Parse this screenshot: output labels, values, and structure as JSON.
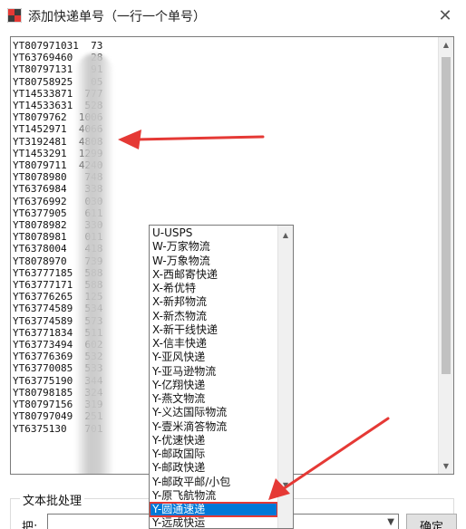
{
  "window": {
    "title": "添加快递单号（一行一个单号）",
    "close_glyph": "✕"
  },
  "tracking_numbers": [
    "YT807971031  73",
    "YT63769460   28",
    "YT80797131   91",
    "YT80758925   05",
    "YT14533871  777",
    "YT14533631  528",
    "YT8079762  1006",
    "YT1452971  4066",
    "YT3192481  4808",
    "YT1453291  1299",
    "YT8079711  4240",
    "YT8078980   748",
    "YT6376984   338",
    "YT6376992   030",
    "YT6377905   611",
    "YT8078982   330",
    "YT8078981   011",
    "YT6378004   418",
    "YT8078970   739",
    "YT63777185  588",
    "YT63777171  588",
    "YT63776265  125",
    "YT63774589  534",
    "YT63774589  573",
    "YT63771834  511",
    "YT63773494  602",
    "YT63776369  532",
    "YT63770085  533",
    "YT63775190  344",
    "YT80798185  324",
    "YT80797156  319",
    "YT80797049  251",
    "YT6375130   701"
  ],
  "courier_options": [
    "U-USPS",
    "W-万家物流",
    "W-万象物流",
    "X-西邮寄快递",
    "X-希优特",
    "X-新邦物流",
    "X-新杰物流",
    "X-新干线快递",
    "X-信丰快递",
    "Y-亚风快递",
    "Y-亚马逊物流",
    "Y-亿翔快递",
    "Y-燕文物流",
    "Y-义达国际物流",
    "Y-壹米滴答物流",
    "Y-优速快递",
    "Y-邮政国际",
    "Y-邮政快递",
    "Y-邮政平邮/小包",
    "Y-原飞航物流",
    "Y-圆通速递",
    "Y-远成快运"
  ],
  "selected_index": 20,
  "batch": {
    "section_label": "文本批处理",
    "field_label": "把:",
    "combo_value": "",
    "ok_label": "确定"
  },
  "colors": {
    "accent": "#0078d7",
    "annotation": "#e53935"
  },
  "icons": {
    "app": "app-logo-icon",
    "close": "close-icon",
    "scroll_up": "chevron-up-icon",
    "scroll_down": "chevron-down-icon",
    "combo": "chevron-down-icon"
  }
}
